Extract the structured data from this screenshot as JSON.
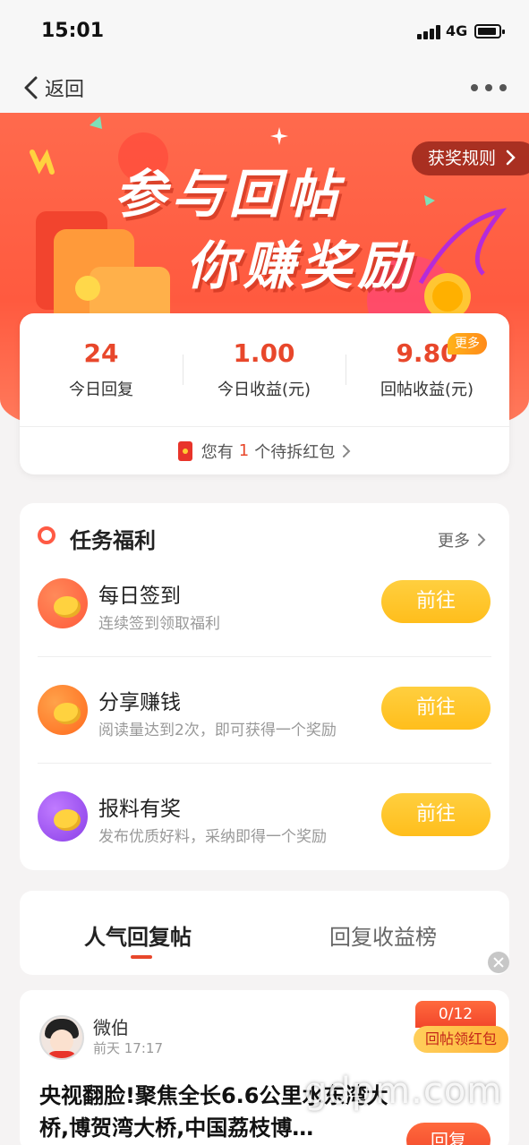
{
  "status_bar": {
    "time": "15:01",
    "network": "4G"
  },
  "nav": {
    "back_label": "返回"
  },
  "banner": {
    "title_line1": "参与回帖",
    "title_line2": "你赚奖励",
    "rules_label": "获奖规则"
  },
  "stats": {
    "items": [
      {
        "value": "24",
        "label": "今日回复"
      },
      {
        "value": "1.00",
        "label": "今日收益(元)"
      },
      {
        "value": "9.80",
        "label": "回帖收益(元)"
      }
    ],
    "more_tag": "更多",
    "redpacket": {
      "prefix": "您有",
      "count": "1",
      "suffix": "个待拆红包"
    }
  },
  "tasks": {
    "title": "任务福利",
    "more_label": "更多",
    "items": [
      {
        "title": "每日签到",
        "desc": "连续签到领取福利",
        "button": "前往",
        "icon": "calendar-checkin-icon",
        "color": "#ff6a3d"
      },
      {
        "title": "分享赚钱",
        "desc": "阅读量达到2次，即可获得一个奖励",
        "button": "前往",
        "icon": "share-money-icon",
        "color": "#ff7b2e"
      },
      {
        "title": "报料有奖",
        "desc": "发布优质好料，采纳即得一个奖励",
        "button": "前往",
        "icon": "megaphone-reward-icon",
        "color": "#9b5cf0"
      }
    ]
  },
  "tabs": {
    "active": "人气回复帖",
    "inactive": "回复收益榜"
  },
  "post": {
    "username": "微伯",
    "time": "前天 17:17",
    "badge_count": "0/12",
    "badge_reward": "回帖领红包",
    "title": "央视翻脸!聚焦全长6.6公里水东湾大桥,博贺湾大桥,中国荔枝博…",
    "reply_label": "回复"
  },
  "watermark": "gdpm.com",
  "colors": {
    "accent": "#e8472b",
    "button_yellow": "#ffc12a",
    "banner": "#ff5a3f"
  }
}
